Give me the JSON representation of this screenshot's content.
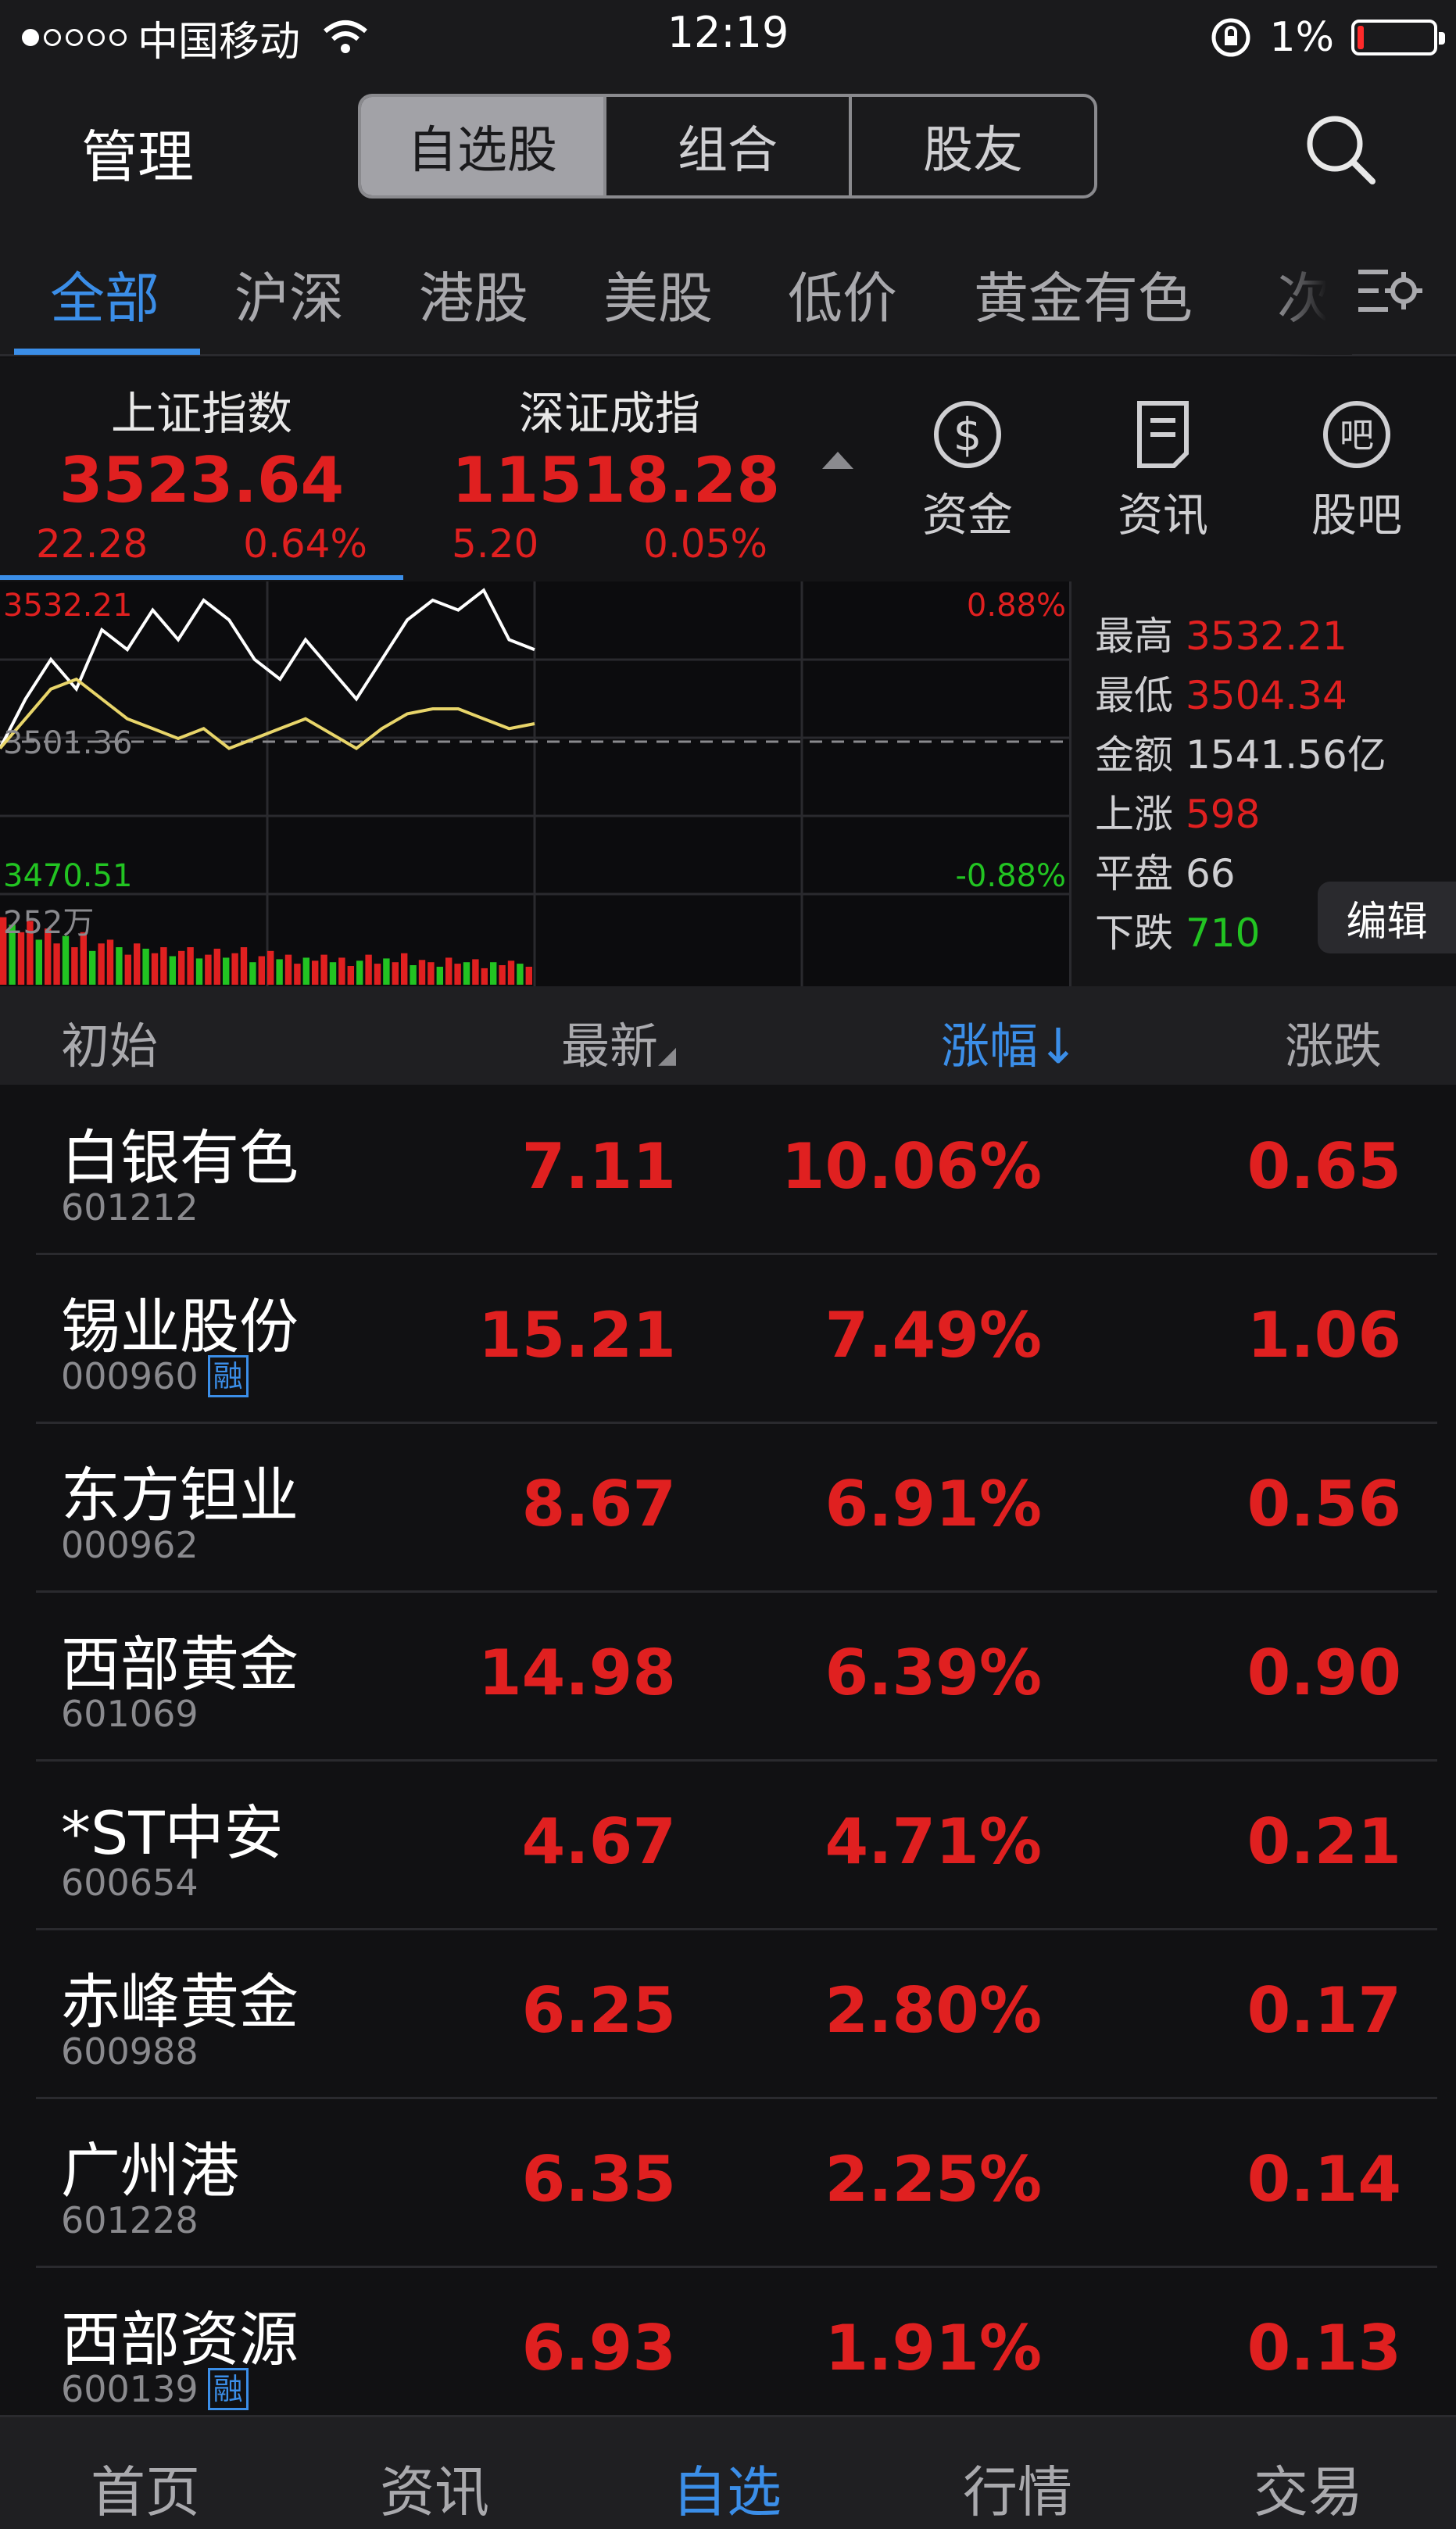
{
  "status_bar": {
    "carrier": "中国移动",
    "time": "12:19",
    "battery": "1%"
  },
  "header": {
    "manage": "管理",
    "segments": [
      "自选股",
      "组合",
      "股友"
    ],
    "active_segment": 0
  },
  "category_tabs": [
    "全部",
    "沪深",
    "港股",
    "美股",
    "低价",
    "黄金有色",
    "次"
  ],
  "indices": [
    {
      "name": "上证指数",
      "value": "3523.64",
      "change": "22.28",
      "percent": "0.64%"
    },
    {
      "name": "深证成指",
      "value": "11518.28",
      "change": "5.20",
      "percent": "0.05%"
    }
  ],
  "quick_actions": [
    "资金",
    "资讯",
    "股吧"
  ],
  "chart": {
    "high_label": "3532.21",
    "pre_close_label": "3501.36",
    "low_label": "3470.51",
    "pct_up": "0.88%",
    "pct_down": "-0.88%",
    "volume_label": "252万"
  },
  "chart_data": {
    "type": "line",
    "ylim": [
      3470.51,
      3532.21
    ],
    "pre_close": 3501.36,
    "series": [
      {
        "color": "#ffffff",
        "values": [
          3500,
          3510,
          3518,
          3512,
          3524,
          3520,
          3528,
          3522,
          3530,
          3526,
          3518,
          3514,
          3522,
          3516,
          3510,
          3518,
          3526,
          3530,
          3528,
          3532,
          3522,
          3520
        ]
      },
      {
        "color": "#e8d56a",
        "values": [
          3500,
          3506,
          3512,
          3514,
          3510,
          3506,
          3504,
          3502,
          3504,
          3500,
          3502,
          3504,
          3506,
          3503,
          3500,
          3504,
          3507,
          3508,
          3508,
          3506,
          3504,
          3505
        ]
      }
    ],
    "volume": [
      0.9,
      0.8,
      0.7,
      0.85,
      0.6,
      0.75,
      0.55,
      0.65,
      0.5,
      0.7,
      0.45,
      0.55,
      0.6,
      0.5,
      0.4,
      0.55,
      0.48,
      0.42,
      0.5,
      0.38,
      0.45,
      0.5,
      0.35,
      0.4,
      0.48,
      0.36,
      0.42,
      0.5,
      0.3,
      0.38,
      0.45,
      0.34,
      0.4,
      0.28,
      0.36,
      0.32,
      0.4,
      0.3,
      0.36,
      0.25,
      0.32,
      0.4,
      0.28,
      0.35,
      0.3,
      0.42,
      0.26,
      0.33,
      0.3,
      0.24,
      0.36,
      0.28,
      0.3,
      0.34,
      0.22,
      0.3,
      0.26,
      0.32,
      0.28,
      0.24
    ]
  },
  "stats": [
    {
      "label": "最高",
      "value": "3532.21",
      "color": "#e02020"
    },
    {
      "label": "最低",
      "value": "3504.34",
      "color": "#e02020"
    },
    {
      "label": "金额",
      "value": "1541.56亿",
      "color": "#cfcfd2"
    },
    {
      "label": "上涨",
      "value": "598",
      "color": "#e02020"
    },
    {
      "label": "平盘",
      "value": "66",
      "color": "#cfcfd2"
    },
    {
      "label": "下跌",
      "value": "710",
      "color": "#22c422"
    }
  ],
  "edit_label": "编辑",
  "list_header": {
    "col1": "初始",
    "col2": "最新",
    "col3": "涨幅",
    "col4": "涨跌"
  },
  "stocks": [
    {
      "name": "白银有色",
      "code": "601212",
      "rong": false,
      "price": "7.11",
      "pct": "10.06%",
      "chg": "0.65"
    },
    {
      "name": "锡业股份",
      "code": "000960",
      "rong": true,
      "price": "15.21",
      "pct": "7.49%",
      "chg": "1.06"
    },
    {
      "name": "东方钽业",
      "code": "000962",
      "rong": false,
      "price": "8.67",
      "pct": "6.91%",
      "chg": "0.56"
    },
    {
      "name": "西部黄金",
      "code": "601069",
      "rong": false,
      "price": "14.98",
      "pct": "6.39%",
      "chg": "0.90"
    },
    {
      "name": "*ST中安",
      "code": "600654",
      "rong": false,
      "price": "4.67",
      "pct": "4.71%",
      "chg": "0.21"
    },
    {
      "name": "赤峰黄金",
      "code": "600988",
      "rong": false,
      "price": "6.25",
      "pct": "2.80%",
      "chg": "0.17"
    },
    {
      "name": "广州港",
      "code": "601228",
      "rong": false,
      "price": "6.35",
      "pct": "2.25%",
      "chg": "0.14"
    },
    {
      "name": "西部资源",
      "code": "600139",
      "rong": true,
      "price": "6.93",
      "pct": "1.91%",
      "chg": "0.13"
    }
  ],
  "rong_label": "融",
  "bottom_tabs": [
    "首页",
    "资讯",
    "自选",
    "行情",
    "交易"
  ],
  "active_bottom_tab": 2
}
